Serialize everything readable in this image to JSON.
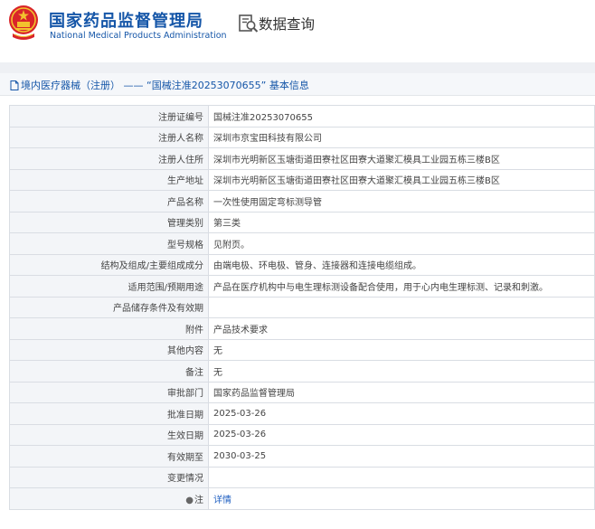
{
  "header": {
    "brand_cn": "国家药品监督管理局",
    "brand_en": "National Medical Products Administration",
    "search_title": "数据查询",
    "brand_color": "#1556a8",
    "emblem_color": "#d9242a",
    "emblem_gold": "#f2c12e"
  },
  "breadcrumb": {
    "text": "境内医疗器械（注册） —— “国械注准20253070655” 基本信息"
  },
  "details": {
    "rows": [
      {
        "label": "注册证编号",
        "value": "国械注准20253070655"
      },
      {
        "label": "注册人名称",
        "value": "深圳市京宝田科技有限公司"
      },
      {
        "label": "注册人住所",
        "value": "深圳市光明新区玉塘街道田寮社区田寮大道聚汇模具工业园五栋三楼B区"
      },
      {
        "label": "生产地址",
        "value": "深圳市光明新区玉塘街道田寮社区田寮大道聚汇模具工业园五栋三楼B区"
      },
      {
        "label": "产品名称",
        "value": "一次性使用固定弯标测导管"
      },
      {
        "label": "管理类别",
        "value": "第三类"
      },
      {
        "label": "型号规格",
        "value": "见附页。"
      },
      {
        "label": "结构及组成/主要组成成分",
        "value": "由端电极、环电极、管身、连接器和连接电缆组成。"
      },
      {
        "label": "适用范围/预期用途",
        "value": "产品在医疗机构中与电生理标测设备配合使用，用于心内电生理标测、记录和刺激。"
      },
      {
        "label": "产品储存条件及有效期",
        "value": ""
      },
      {
        "label": "附件",
        "value": "产品技术要求"
      },
      {
        "label": "其他内容",
        "value": "无"
      },
      {
        "label": "备注",
        "value": "无"
      },
      {
        "label": "审批部门",
        "value": "国家药品监督管理局"
      },
      {
        "label": "批准日期",
        "value": "2025-03-26"
      },
      {
        "label": "生效日期",
        "value": "2025-03-26"
      },
      {
        "label": "有效期至",
        "value": "2030-03-25"
      },
      {
        "label": "变更情况",
        "value": ""
      }
    ],
    "notes_label": "注",
    "notes_icon": "info-circle-icon",
    "notes_link": "详情"
  }
}
